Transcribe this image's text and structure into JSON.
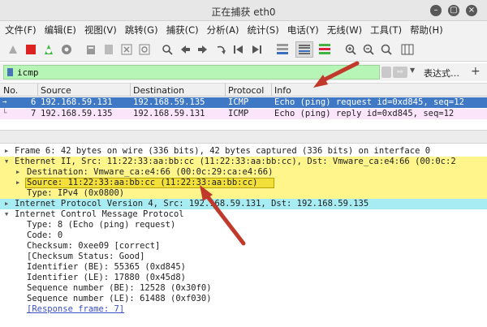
{
  "window": {
    "title": "正在捕获 eth0",
    "buttons": [
      "minimize-icon",
      "maximize-icon",
      "close-icon"
    ]
  },
  "menu": [
    "文件(F)",
    "编辑(E)",
    "视图(V)",
    "跳转(G)",
    "捕获(C)",
    "分析(A)",
    "统计(S)",
    "电话(Y)",
    "无线(W)",
    "工具(T)",
    "帮助(H)"
  ],
  "filter": {
    "value": "icmp",
    "expression_label": "表达式…",
    "plus_label": "+",
    "arrow_label": "⇨"
  },
  "columns": [
    "No.",
    "Source",
    "Destination",
    "Protocol",
    "Info"
  ],
  "packets": [
    {
      "no": "6",
      "src": "192.168.59.131",
      "dst": "192.168.59.135",
      "proto": "ICMP",
      "info": "Echo (ping) request  id=0xd845, seq=12"
    },
    {
      "no": "7",
      "src": "192.168.59.135",
      "dst": "192.168.59.131",
      "proto": "ICMP",
      "info": "Echo (ping) reply    id=0xd845, seq=12"
    }
  ],
  "details": [
    "Frame 6: 42 bytes on wire (336 bits), 42 bytes captured (336 bits) on interface 0",
    "Ethernet II, Src: 11:22:33:aa:bb:cc (11:22:33:aa:bb:cc), Dst: Vmware_ca:e4:66 (00:0c:2",
    "Destination: Vmware_ca:e4:66 (00:0c:29:ca:e4:66)",
    "Source: 11:22:33:aa:bb:cc (11:22:33:aa:bb:cc)",
    "Type: IPv4 (0x0800)",
    "Internet Protocol Version 4, Src: 192.168.59.131, Dst: 192.168.59.135",
    "Internet Control Message Protocol",
    "Type: 8 (Echo (ping) request)",
    "Code: 0",
    "Checksum: 0xee09 [correct]",
    "[Checksum Status: Good]",
    "Identifier (BE): 55365 (0xd845)",
    "Identifier (LE): 17880 (0x45d8)",
    "Sequence number (BE): 12528 (0x30f0)",
    "Sequence number (LE): 61488 (0xf030)",
    "[Response frame: 7]"
  ],
  "colors": {
    "selected_row": "#3f79c5",
    "reply_row": "#fbe5fb",
    "filter_ok": "#b7f5b7",
    "ethernet_highlight": "#fff58a",
    "ip_highlight": "#a8ecf3",
    "annotation": "#c0392b"
  }
}
